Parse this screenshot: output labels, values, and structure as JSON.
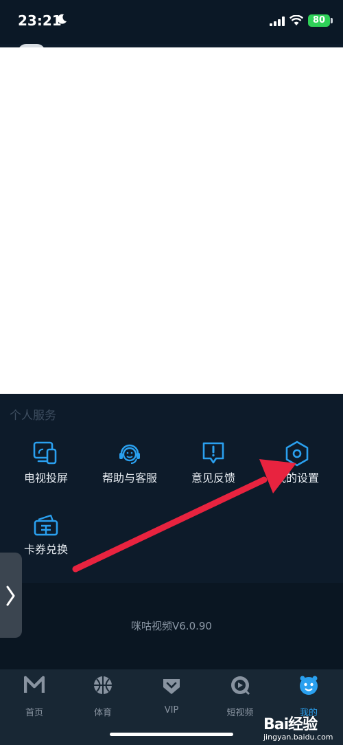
{
  "status": {
    "time": "23:21",
    "battery": "80"
  },
  "services": {
    "title": "个人服务",
    "items": [
      {
        "label": "电视投屏",
        "icon": "tv-cast-icon"
      },
      {
        "label": "帮助与客服",
        "icon": "customer-service-icon"
      },
      {
        "label": "意见反馈",
        "icon": "feedback-icon"
      },
      {
        "label": "我的设置",
        "icon": "settings-icon"
      },
      {
        "label": "卡券兑换",
        "icon": "coupon-icon"
      }
    ]
  },
  "footer": {
    "version": "咪咕视频V6.0.90"
  },
  "tabs": [
    {
      "label": "首页",
      "icon": "home-logo-icon"
    },
    {
      "label": "体育",
      "icon": "sports-ball-icon"
    },
    {
      "label": "VIP",
      "icon": "vip-icon"
    },
    {
      "label": "短视频",
      "icon": "short-video-icon"
    },
    {
      "label": "我的",
      "icon": "mine-face-icon",
      "active": true
    }
  ],
  "watermark": {
    "main": "Bai经验",
    "sub": "jingyan.baidu.com"
  },
  "colors": {
    "accent": "#2aa0ef",
    "background": "#0d1b2a",
    "arrow": "#e8233f"
  }
}
